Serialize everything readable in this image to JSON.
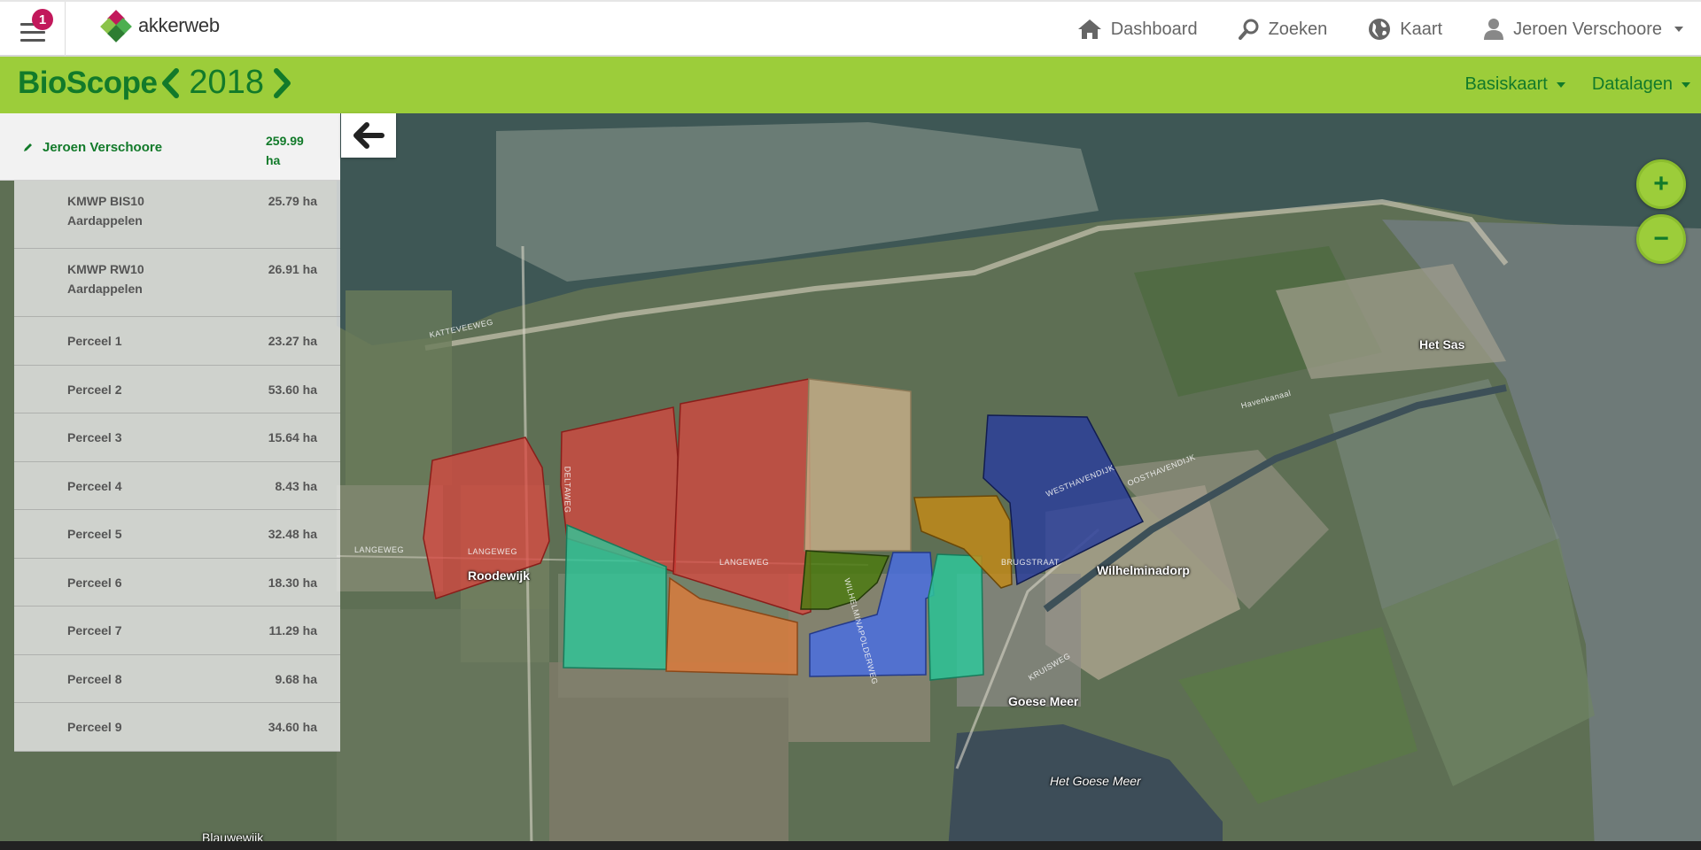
{
  "topbar": {
    "notification_count": "1",
    "logo_text": "akkerweb",
    "nav": [
      {
        "label": "Dashboard",
        "icon": "home-icon"
      },
      {
        "label": "Zoeken",
        "icon": "search-icon"
      },
      {
        "label": "Kaart",
        "icon": "globe-icon"
      },
      {
        "label": "Jeroen Verschoore",
        "icon": "user-icon"
      }
    ]
  },
  "header": {
    "title": "BioScope",
    "year": "2018",
    "basiskaart": "Basiskaart",
    "datalagen": "Datalagen"
  },
  "panel": {
    "owner": "Jeroen Verschoore",
    "total_area": "259.99 ha",
    "fields": [
      {
        "name": "KMWP BIS10 Aardappelen",
        "area": "25.79 ha"
      },
      {
        "name": "KMWP RW10 Aardappelen",
        "area": "26.91 ha"
      },
      {
        "name": "Perceel 1",
        "area": "23.27 ha"
      },
      {
        "name": "Perceel 2",
        "area": "53.60 ha"
      },
      {
        "name": "Perceel 3",
        "area": "15.64 ha"
      },
      {
        "name": "Perceel 4",
        "area": "8.43 ha"
      },
      {
        "name": "Perceel 5",
        "area": "32.48 ha"
      },
      {
        "name": "Perceel 6",
        "area": "18.30 ha"
      },
      {
        "name": "Perceel 7",
        "area": "11.29 ha"
      },
      {
        "name": "Perceel 8",
        "area": "9.68 ha"
      },
      {
        "name": "Perceel 9",
        "area": "34.60 ha"
      }
    ]
  },
  "map": {
    "zoom_in": "+",
    "zoom_out": "−",
    "places": {
      "wilhelminadorp": "Wilhelminadorp",
      "roodewijk": "Roodewijk",
      "goese_meer": "Goese Meer",
      "het_goese_meer": "Het Goese Meer",
      "het_sas": "Het Sas",
      "blauwewijk": "Blauwewijk"
    },
    "roads": {
      "langeweg_1": "LANGEWEG",
      "langeweg_2": "LANGEWEG",
      "langeweg_3": "LANGEWEG",
      "deltaweg": "DELTAWEG",
      "brugstraat": "BRUGSTRAAT",
      "westhavendijk": "WESTHAVENDIJK",
      "oosthavendijk": "OOSTHAVENDIJK",
      "kruisweg": "KRUISWEG",
      "katteweg": "KATTEVEEWEG",
      "wilhelminapolderweg": "WILHELMINAPOLDERWEG",
      "havenkanaal": "Havenkanaal"
    },
    "colors": {
      "red": "#d9453f",
      "teal": "#2fc79a",
      "orange": "#e07a3a",
      "tan": "#c9b08a",
      "olive": "#4c7a12",
      "blue": "#4a6fe0",
      "darkblue": "#2c3f9a",
      "gold": "#c08a1a"
    }
  }
}
